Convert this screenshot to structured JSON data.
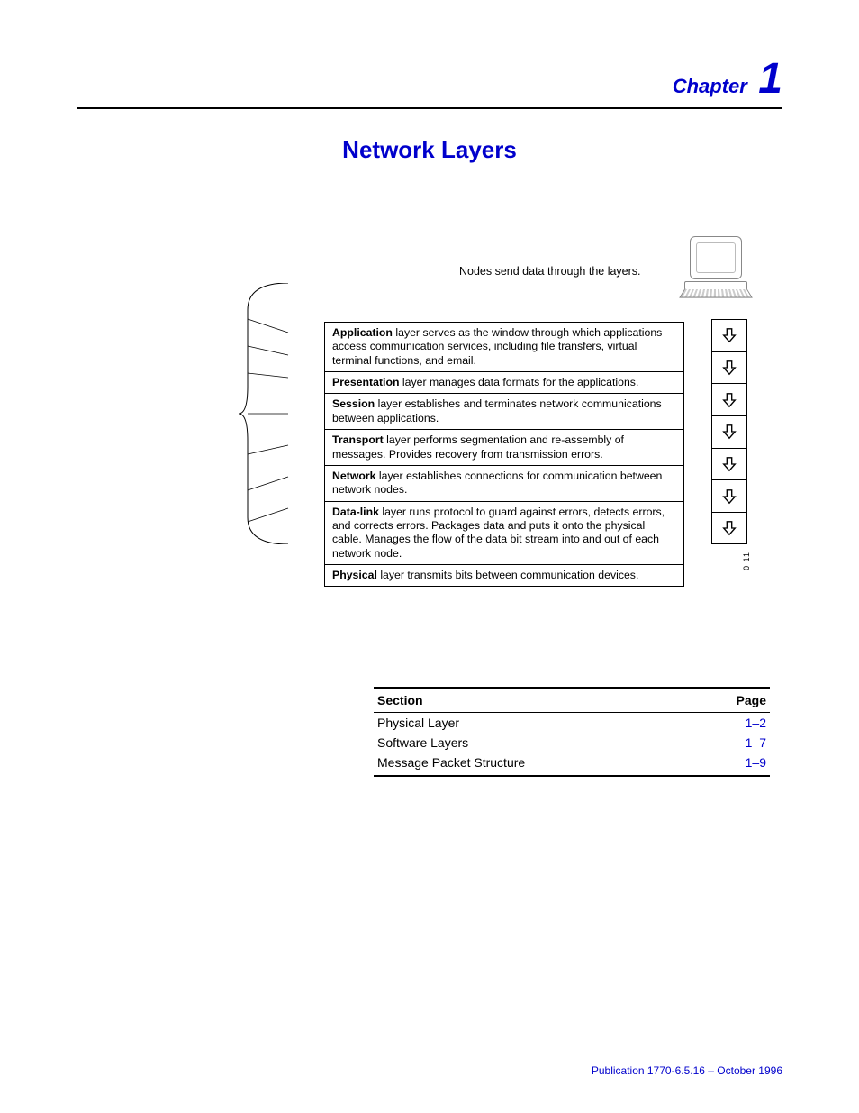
{
  "header": {
    "chapter_label": "Chapter",
    "chapter_number": "1"
  },
  "title": "Network Layers",
  "diagram": {
    "caption": "Nodes send data through the layers.",
    "side_label": "0 11",
    "layers": [
      {
        "name": "Application",
        "desc": " layer serves as the window through which applications access communication services, including file transfers, virtual terminal functions, and email."
      },
      {
        "name": "Presentation",
        "desc": " layer manages data formats for the applications."
      },
      {
        "name": "Session",
        "desc": " layer establishes and terminates network communications between applications."
      },
      {
        "name": "Transport",
        "desc": " layer performs segmentation and re-assembly of messages.  Provides recovery from transmission errors."
      },
      {
        "name": "Network",
        "desc": " layer establishes connections for communication between network nodes."
      },
      {
        "name": "Data-link",
        "desc": " layer runs protocol to guard against errors, detects errors, and corrects errors.  Packages data and puts it onto the physical cable.  Manages the flow of the data bit stream into and out of each network node."
      },
      {
        "name": "Physical",
        "desc": " layer transmits bits between communication devices."
      }
    ]
  },
  "toc": {
    "headers": {
      "section": "Section",
      "page": "Page"
    },
    "rows": [
      {
        "section": "Physical Layer",
        "page": "1–2"
      },
      {
        "section": "Software Layers",
        "page": "1–7"
      },
      {
        "section": "Message Packet Structure",
        "page": "1–9"
      }
    ]
  },
  "footer": "Publication 1770-6.5.16 – October 1996"
}
